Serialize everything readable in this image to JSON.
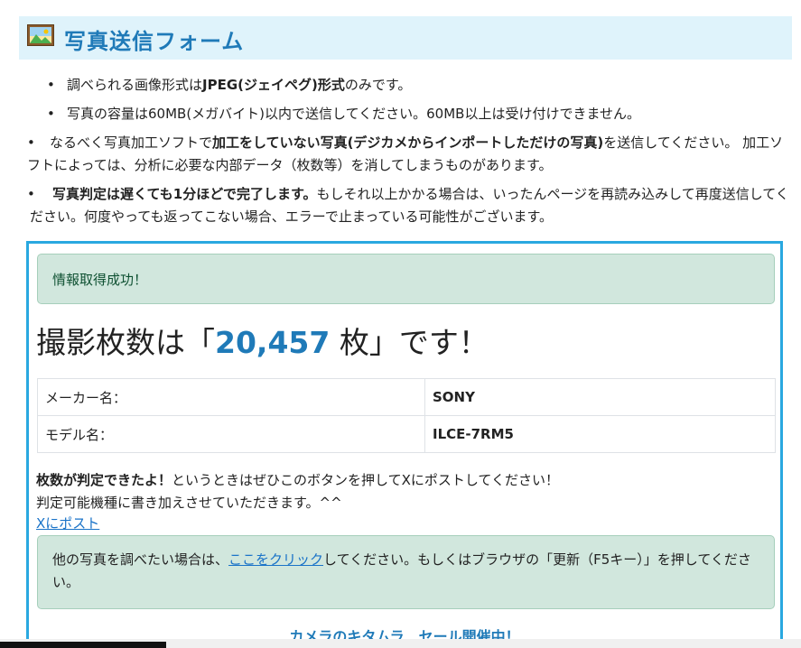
{
  "header": {
    "title": "写真送信フォーム",
    "icon": "picture-icon"
  },
  "notes": [
    {
      "pre": "調べられる画像形式は",
      "bold": "JPEG(ジェイペグ)形式",
      "post": "のみです。"
    },
    {
      "text": "写真の容量は60MB(メガバイト)以内で送信してください。60MB以上は受け付けできません。"
    },
    {
      "pre": "なるべく写真加工ソフトで",
      "bold": "加工をしていない写真(デジカメからインポートしただけの写真)",
      "post": "を送信してください。 加工ソフトによっては、分析に必要な内部データ（枚数等）を消してしまうものがあります。"
    },
    {
      "bold": "写真判定は遅くても1分ほどで完了します。",
      "post": "もしそれ以上かかる場合は、いったんページを再読み込みして再度送信してください。何度やっても返ってこない場合、エラーで止まっている可能性がございます。"
    }
  ],
  "result": {
    "success_message": "情報取得成功！",
    "count_prefix": "撮影枚数は「",
    "count_value": "20,457",
    "count_suffix": " 枚」です！",
    "table": [
      {
        "key": "メーカー名：",
        "value": "SONY"
      },
      {
        "key": "モデル名：",
        "value": "ILCE-7RM5"
      }
    ],
    "post_note_bold": "枚数が判定できたよ！",
    "post_note_rest": "というときはぜひこのボタンを押してXにポストしてください！",
    "post_note_line2": "判定可能機種に書き加えさせていただきます。^^",
    "post_link": "Xにポスト",
    "retry_pre": "他の写真を調べたい場合は、",
    "retry_link": "ここをクリック",
    "retry_post": "してください。もしくはブラウザの「更新（F5キー）」を押してください。",
    "sale_text": "カメラのキタムラ　セール開催中！"
  },
  "colors": {
    "accent": "#1f7ab8",
    "header_bg": "#dff3fb",
    "panel_border": "#29a8e0",
    "success_bg": "#d1e7dd",
    "link": "#1a73c8"
  }
}
